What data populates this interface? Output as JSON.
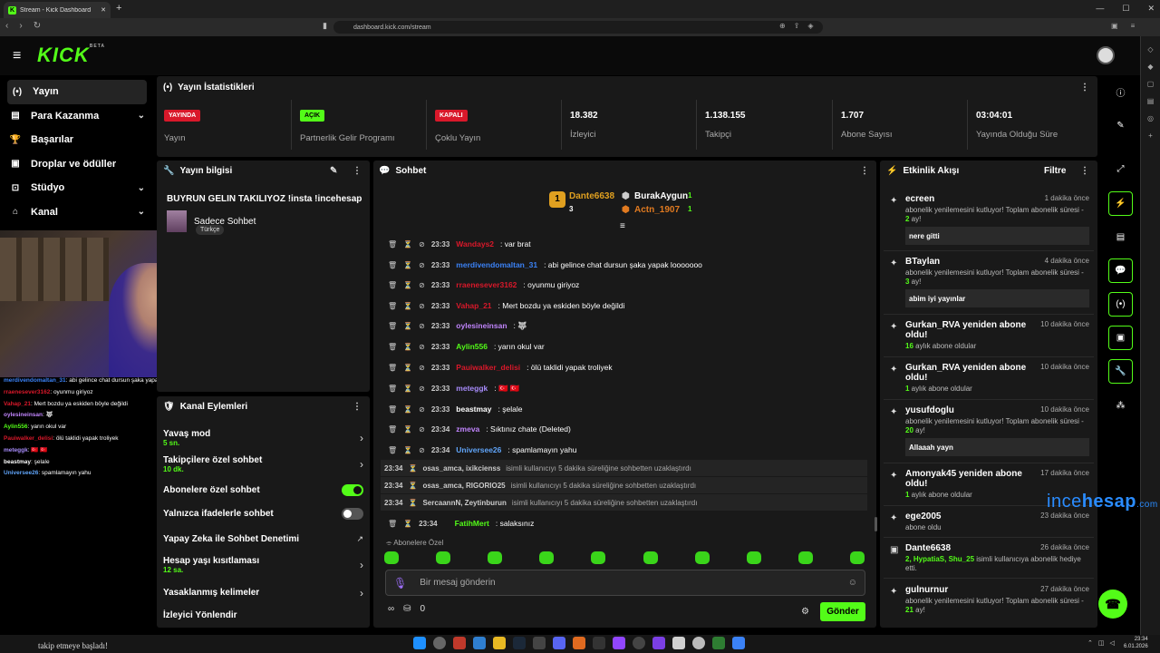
{
  "browser": {
    "tab_title": "Stream - Kick Dashboard",
    "tab_favicon": "K",
    "url": "dashboard.kick.com/stream"
  },
  "header": {
    "logo": "KICK",
    "logo_badge": "BETA"
  },
  "nav": [
    {
      "icon": "(•)",
      "label": "Yayın",
      "active": true,
      "chevron": false
    },
    {
      "icon": "▤",
      "label": "Para Kazanma",
      "chevron": true
    },
    {
      "icon": "🏆",
      "label": "Başarılar",
      "chevron": false
    },
    {
      "icon": "▣",
      "label": "Droplar ve ödüller",
      "chevron": false
    },
    {
      "icon": "⊡",
      "label": "Stüdyo",
      "chevron": true
    },
    {
      "icon": "⌂",
      "label": "Kanal",
      "chevron": true
    }
  ],
  "stats": {
    "title": "Yayın İstatistikleri",
    "items": [
      {
        "badge": "YAYINDA",
        "badge_color": "red",
        "label": "Yayın"
      },
      {
        "badge": "AÇIK",
        "badge_color": "green",
        "label": "Partnerlik Gelir Programı"
      },
      {
        "badge": "KAPALI",
        "badge_color": "red",
        "label": "Çoklu Yayın"
      },
      {
        "value": "18.382",
        "label": "İzleyici"
      },
      {
        "value": "1.138.155",
        "label": "Takipçi"
      },
      {
        "value": "1.707",
        "label": "Abone Sayısı"
      },
      {
        "value": "03:04:01",
        "label": "Yayında Olduğu Süre"
      }
    ]
  },
  "info": {
    "title": "Yayın bilgisi",
    "stream_title": "BUYRUN GELIN TAKILIYOZ !insta !incehesap",
    "category": "Sadece Sohbet",
    "tag": "Türkçe"
  },
  "actions": {
    "title": "Kanal Eylemleri",
    "items": [
      {
        "label": "Yavaş mod",
        "sub": "5 sn.",
        "type": "arrow"
      },
      {
        "label": "Takipçilere özel sohbet",
        "sub": "10 dk.",
        "type": "arrow"
      },
      {
        "label": "Abonelere özel sohbet",
        "type": "toggle_on"
      },
      {
        "label": "Yalnızca ifadelerle sohbet",
        "type": "toggle_off"
      },
      {
        "label": "Yapay Zeka ile Sohbet Denetimi",
        "type": "external"
      },
      {
        "label": "Hesap yaşı kısıtlaması",
        "sub": "12 sa.",
        "type": "arrow"
      },
      {
        "label": "Yasaklanmış kelimeler",
        "type": "arrow"
      },
      {
        "label": "İzleyici Yönlendir",
        "type": "none"
      }
    ]
  },
  "chat": {
    "title": "Sohbet",
    "leaderboard": {
      "first": {
        "name": "Dante6638",
        "count": "3"
      },
      "second": {
        "name": "BurakAygun",
        "count": "1"
      },
      "third": {
        "name": "Actn_1907",
        "count": "1"
      }
    },
    "messages": [
      {
        "time": "23:33",
        "user": "Wandays2",
        "color": "#d9182a",
        "text": ": var brat"
      },
      {
        "time": "23:33",
        "user": "merdivendomaltan_31",
        "color": "#3b82f6",
        "text": ": abi gelince chat dursun şaka yapak looooooo"
      },
      {
        "time": "23:33",
        "user": "rraenesever3162",
        "color": "#d9182a",
        "text": ": oyunmu giriyoz"
      },
      {
        "time": "23:33",
        "user": "Vahap_21",
        "color": "#d9182a",
        "text": ": Mert bozdu ya eskiden böyle değildi"
      },
      {
        "time": "23:33",
        "user": "oylesineinsan",
        "color": "#c084fc",
        "text": ": 🐺"
      },
      {
        "time": "23:33",
        "user": "Aylin556",
        "color": "#53fc18",
        "text": ": yarın okul var"
      },
      {
        "time": "23:33",
        "user": "Pauiwalker_delisi",
        "color": "#d9182a",
        "text": ": ölü taklidi yapak troliyek"
      },
      {
        "time": "23:33",
        "user": "meteggk",
        "color": "#a78bfa",
        "text": ": 🇹🇷 🇹🇷"
      },
      {
        "time": "23:33",
        "user": "beastmay",
        "color": "#ffffff",
        "text": ": şelale"
      },
      {
        "time": "23:34",
        "user": "zmeva",
        "color": "#c084fc",
        "text": ": Sıktınız chate (Deleted)"
      },
      {
        "time": "23:34",
        "user": "Universee26",
        "color": "#60a5fa",
        "text": ": spamlamayın yahu"
      }
    ],
    "system": [
      {
        "time": "23:34",
        "users": "osas_amca, ixikcienss",
        "text": "isimli kullanıcıyı 5 dakika süreliğine sohbetten uzaklaştırdı"
      },
      {
        "time": "23:34",
        "users": "osas_amca, RIGORIO25",
        "text": "isimli kullanıcıyı 5 dakika süreliğine sohbetten uzaklaştırdı"
      },
      {
        "time": "23:34",
        "users": "SercaannN, Zeytinburun",
        "text": "isimli kullanıcıyı 5 dakika süreliğine sohbetten uzaklaştırdı"
      }
    ],
    "last_message": {
      "time": "23:34",
      "user": "FatihMert",
      "color": "#53fc18",
      "text": ": salaksınız"
    },
    "sub_only_label": "Abonelere Özel",
    "placeholder": "Bir mesaj gönderin",
    "points": "0",
    "send_label": "Gönder"
  },
  "activity": {
    "title": "Etkinlik Akışı",
    "filter_label": "Filtre",
    "events": [
      {
        "icon": "✦",
        "name": "ecreen",
        "ago": "1 dakika önce",
        "sub": "abonelik yenilemesini kutluyor! Toplam abonelik süresi - ",
        "num": "2",
        "tail": " ay!",
        "box": "nere gitti"
      },
      {
        "icon": "✦",
        "name": "BTaylan",
        "ago": "4 dakika önce",
        "sub": "abonelik yenilemesini kutluyor! Toplam abonelik süresi - ",
        "num": "3",
        "tail": " ay!",
        "box": "abim iyi yayınlar"
      },
      {
        "icon": "✦",
        "name": "Gurkan_RVA yeniden abone oldu!",
        "ago": "10 dakika önce",
        "num": "16",
        "sub2": " aylık abone oldular"
      },
      {
        "icon": "✦",
        "name": "Gurkan_RVA yeniden abone oldu!",
        "ago": "10 dakika önce",
        "num": "1",
        "sub2": " aylık abone oldular"
      },
      {
        "icon": "✦",
        "name": "yusufdoglu",
        "ago": "10 dakika önce",
        "sub": "abonelik yenilemesini kutluyor! Toplam abonelik süresi - ",
        "num": "20",
        "tail": " ay!",
        "box": "Allaaah yayn"
      },
      {
        "icon": "✦",
        "name": "Amonyak45 yeniden abone oldu!",
        "ago": "17 dakika önce",
        "num": "1",
        "sub2": " aylık abone oldular"
      },
      {
        "icon": "✦",
        "name": "ege2005",
        "ago": "23 dakika önce",
        "sub3": "abone oldu"
      },
      {
        "icon": "▣",
        "name": "Dante6638",
        "ago": "26 dakika önce",
        "gift": "2, HypatiaS, Shu_25",
        "gift_tail": " isimli kullanıcıya abonelik hediye etti."
      },
      {
        "icon": "✦",
        "name": "gulnurnur",
        "ago": "27 dakika önce",
        "sub": "abonelik yenilemesini kutluyor! Toplam abonelik süresi - ",
        "num": "21",
        "tail": " ay!"
      }
    ]
  },
  "overlay_chat": [
    {
      "user": "merdivendomaltan_31",
      "color": "#3b82f6",
      "text": ": abi gelince chat dursun şaka yapak looooooo"
    },
    {
      "user": "rraenesever3162",
      "color": "#d9182a",
      "text": ": oyunmu giriyoz"
    },
    {
      "user": "Vahap_21",
      "color": "#d9182a",
      "text": ": Mert bozdu ya eskiden böyle değildi"
    },
    {
      "user": "oylesineinsan",
      "color": "#c084fc",
      "text": ": 🐺"
    },
    {
      "user": "Aylin556",
      "color": "#53fc18",
      "text": ": yarın okul var"
    },
    {
      "user": "Pauiwalker_delisi",
      "color": "#d9182a",
      "text": ": ölü taklidi yapak troliyek"
    },
    {
      "user": "meteggk",
      "color": "#a78bfa",
      "text": ": 🇹🇷 🇹🇷"
    },
    {
      "user": "beastmay",
      "color": "#ffffff",
      "text": ": şelale"
    },
    {
      "user": "Universee26",
      "color": "#60a5fa",
      "text": ": spamlamayın yahu"
    }
  ],
  "watermark": {
    "a": "ince",
    "b": "hesap",
    "c": ".com"
  },
  "taskbar": {
    "ticker": "takip etmeye başladı!",
    "time": "23:34",
    "date": "6.01.2026"
  }
}
